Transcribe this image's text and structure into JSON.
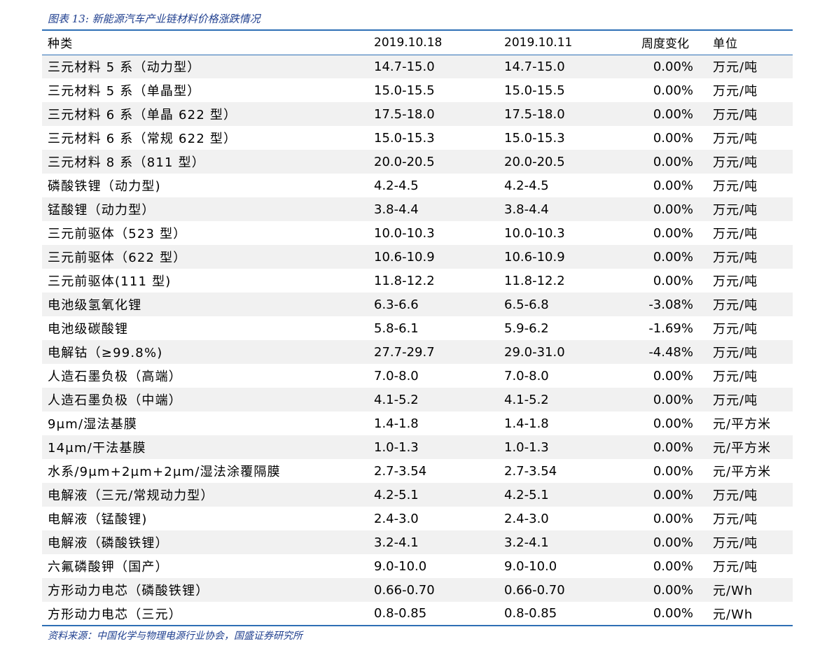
{
  "caption": "图表 13: 新能源汽车产业链材料价格涨跌情况",
  "headers": [
    "种类",
    "2019.10.18",
    "2019.10.11",
    "周度变化",
    "单位"
  ],
  "rows": [
    [
      "三元材料 5 系（动力型）",
      "14.7-15.0",
      "14.7-15.0",
      "0.00%",
      "万元/吨"
    ],
    [
      "三元材料 5 系（单晶型）",
      "15.0-15.5",
      "15.0-15.5",
      "0.00%",
      "万元/吨"
    ],
    [
      "三元材料 6 系（单晶 622 型）",
      "17.5-18.0",
      "17.5-18.0",
      "0.00%",
      "万元/吨"
    ],
    [
      "三元材料 6 系（常规 622 型）",
      "15.0-15.3",
      "15.0-15.3",
      "0.00%",
      "万元/吨"
    ],
    [
      "三元材料 8 系（811 型）",
      "20.0-20.5",
      "20.0-20.5",
      "0.00%",
      "万元/吨"
    ],
    [
      "磷酸铁锂（动力型)",
      "4.2-4.5",
      "4.2-4.5",
      "0.00%",
      "万元/吨"
    ],
    [
      "锰酸锂（动力型）",
      "3.8-4.4",
      "3.8-4.4",
      "0.00%",
      "万元/吨"
    ],
    [
      "三元前驱体（523 型）",
      "10.0-10.3",
      "10.0-10.3",
      "0.00%",
      "万元/吨"
    ],
    [
      "三元前驱体（622 型）",
      "10.6-10.9",
      "10.6-10.9",
      "0.00%",
      "万元/吨"
    ],
    [
      "三元前驱体(111 型)",
      "11.8-12.2",
      "11.8-12.2",
      "0.00%",
      "万元/吨"
    ],
    [
      "电池级氢氧化锂",
      "6.3-6.6",
      "6.5-6.8",
      "-3.08%",
      "万元/吨"
    ],
    [
      "电池级碳酸锂",
      "5.8-6.1",
      "5.9-6.2",
      "-1.69%",
      "万元/吨"
    ],
    [
      "电解钴（≥99.8%)",
      "27.7-29.7",
      "29.0-31.0",
      "-4.48%",
      "万元/吨"
    ],
    [
      "人造石墨负极（高端）",
      "7.0-8.0",
      "7.0-8.0",
      "0.00%",
      "万元/吨"
    ],
    [
      "人造石墨负极（中端）",
      "4.1-5.2",
      "4.1-5.2",
      "0.00%",
      "万元/吨"
    ],
    [
      "9μm/湿法基膜",
      "1.4-1.8",
      "1.4-1.8",
      "0.00%",
      "元/平方米"
    ],
    [
      "14μm/干法基膜",
      "1.0-1.3",
      "1.0-1.3",
      "0.00%",
      "元/平方米"
    ],
    [
      "水系/9μm+2μm+2μm/湿法涂覆隔膜",
      "2.7-3.54",
      "2.7-3.54",
      "0.00%",
      "元/平方米"
    ],
    [
      "电解液（三元/常规动力型）",
      "4.2-5.1",
      "4.2-5.1",
      "0.00%",
      "万元/吨"
    ],
    [
      "电解液（锰酸锂)",
      "2.4-3.0",
      "2.4-3.0",
      "0.00%",
      "万元/吨"
    ],
    [
      "电解液（磷酸铁锂）",
      "3.2-4.1",
      "3.2-4.1",
      "0.00%",
      "万元/吨"
    ],
    [
      "六氟磷酸钾（国产）",
      "9.0-10.0",
      "9.0-10.0",
      "0.00%",
      "万元/吨"
    ],
    [
      "方形动力电芯（磷酸铁锂）",
      "0.66-0.70",
      "0.66-0.70",
      "0.00%",
      "元/Wh"
    ],
    [
      "方形动力电芯（三元）",
      "0.8-0.85",
      "0.8-0.85",
      "0.00%",
      "元/Wh"
    ]
  ],
  "source": "资料来源：中国化学与物理电源行业协会，国盛证券研究所",
  "colors": {
    "accent_line": "#2e6fb5",
    "caption_text": "#1f3f8f",
    "stripe": "#f1f1f1"
  }
}
